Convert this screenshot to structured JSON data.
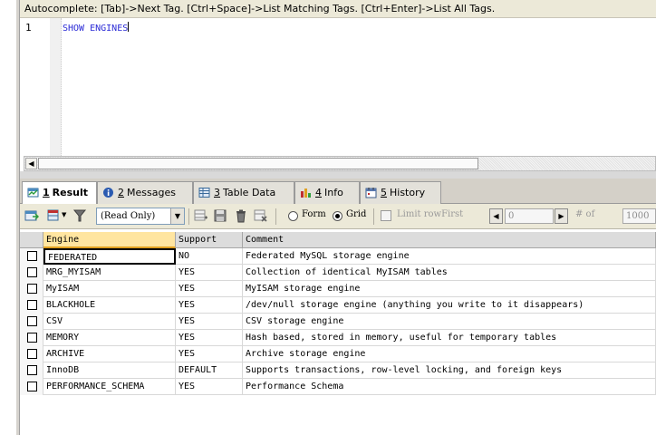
{
  "hint_text": "Autocomplete: [Tab]->Next Tag. [Ctrl+Space]->List Matching Tags. [Ctrl+Enter]->List All Tags.",
  "editor": {
    "line_number": "1",
    "code": "SHOW ENGINES"
  },
  "tabs": [
    {
      "num": "1",
      "label": "Result",
      "icon": "result-grid-icon",
      "active": true
    },
    {
      "num": "2",
      "label": "Messages",
      "icon": "info-circle-icon",
      "active": false
    },
    {
      "num": "3",
      "label": "Table Data",
      "icon": "table-icon",
      "active": false
    },
    {
      "num": "4",
      "label": "Info",
      "icon": "info-bars-icon",
      "active": false
    },
    {
      "num": "5",
      "label": "History",
      "icon": "calendar-icon",
      "active": false
    }
  ],
  "toolbar": {
    "mode_value": "(Read Only)",
    "form_label": "Form",
    "grid_label": "Grid",
    "view_selected": "grid",
    "limit_label": "Limit rowFirst",
    "limit_checked": false,
    "first_row_value": "0",
    "rows_label": "# of",
    "rows_value": "1000"
  },
  "grid": {
    "columns": [
      "Engine",
      "Support",
      "Comment"
    ],
    "rows": [
      [
        "FEDERATED",
        "NO",
        "Federated MySQL storage engine"
      ],
      [
        "MRG_MYISAM",
        "YES",
        "Collection of identical MyISAM tables"
      ],
      [
        "MyISAM",
        "YES",
        "MyISAM storage engine"
      ],
      [
        "BLACKHOLE",
        "YES",
        "/dev/null storage engine (anything you write to it disappears)"
      ],
      [
        "CSV",
        "YES",
        "CSV storage engine"
      ],
      [
        "MEMORY",
        "YES",
        "Hash based, stored in memory, useful for temporary tables"
      ],
      [
        "ARCHIVE",
        "YES",
        "Archive storage engine"
      ],
      [
        "InnoDB",
        "DEFAULT",
        "Supports transactions, row-level locking, and foreign keys"
      ],
      [
        "PERFORMANCE_SCHEMA",
        "YES",
        "Performance Schema"
      ]
    ]
  }
}
